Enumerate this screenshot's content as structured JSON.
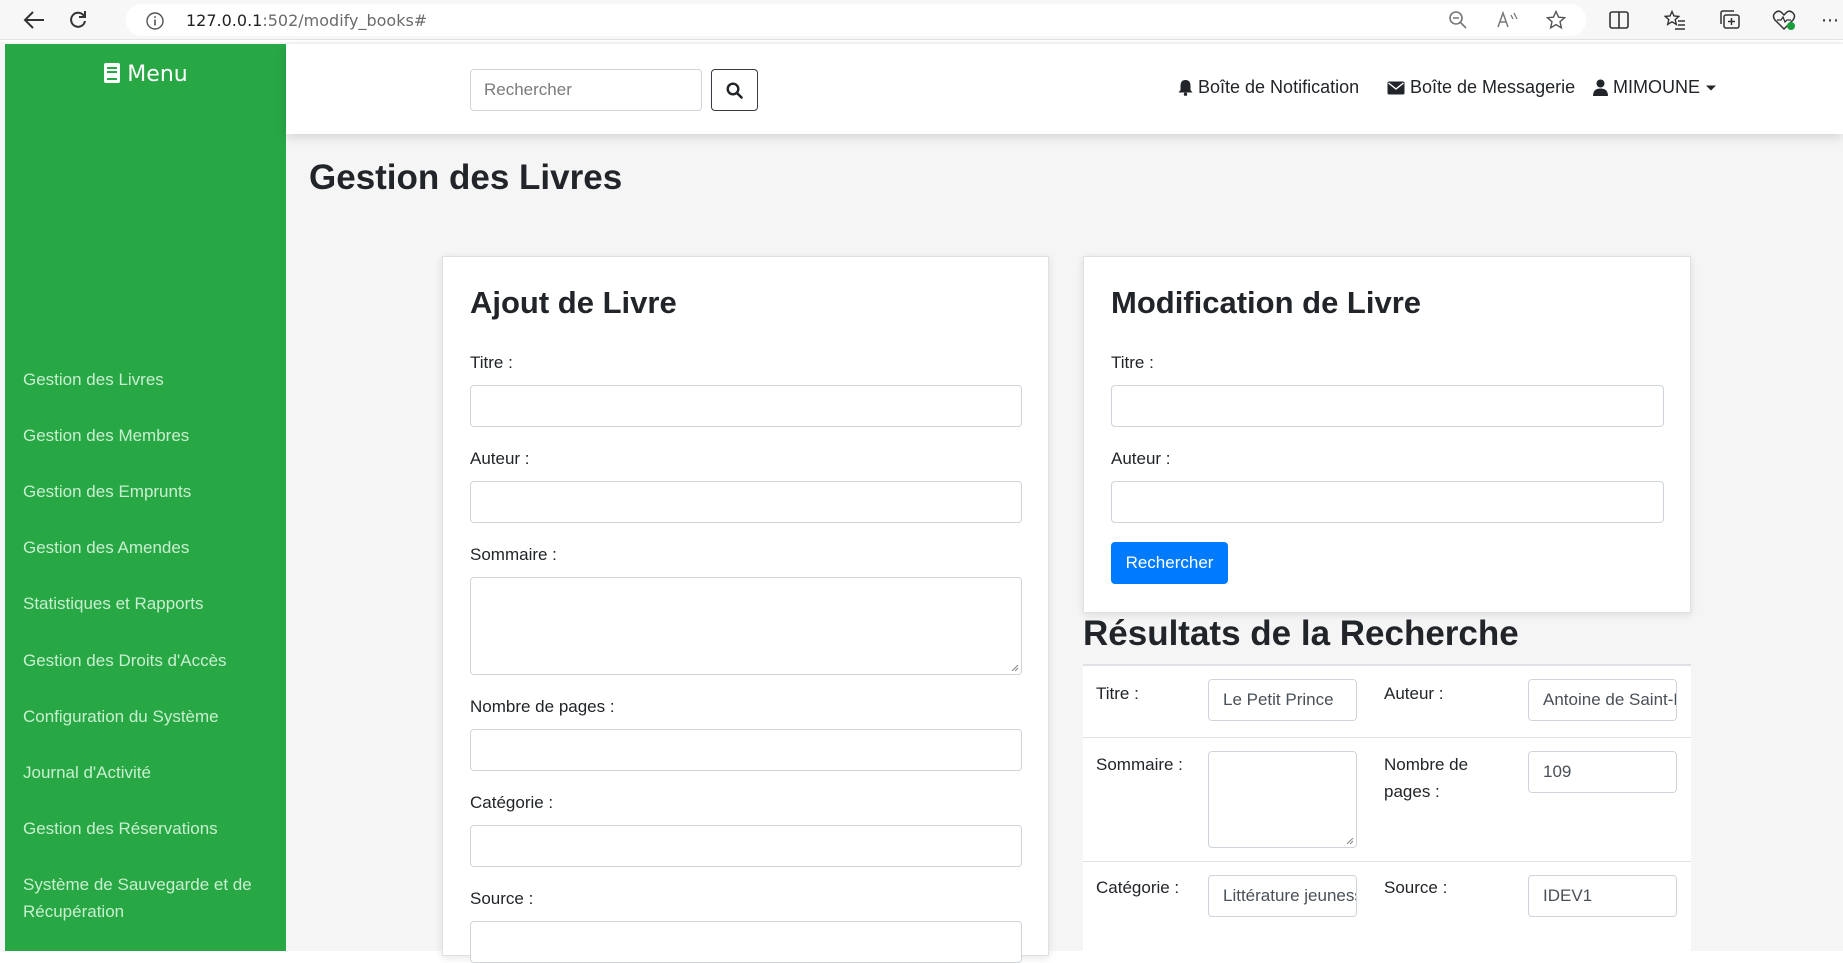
{
  "browser": {
    "url_host": "127.0.0.1",
    "url_path": ":502/modify_books#"
  },
  "sidebar": {
    "title": "Menu",
    "items": [
      {
        "label": "Gestion des Livres"
      },
      {
        "label": "Gestion des Membres"
      },
      {
        "label": "Gestion des Emprunts"
      },
      {
        "label": "Gestion des Amendes"
      },
      {
        "label": "Statistiques et Rapports"
      },
      {
        "label": "Gestion des Droits d'Accès"
      },
      {
        "label": "Configuration du Système"
      },
      {
        "label": "Journal d'Activité"
      },
      {
        "label": "Gestion des Réservations"
      },
      {
        "label": "Système de Sauvegarde et de Récupération"
      }
    ]
  },
  "topbar": {
    "search_placeholder": "Rechercher",
    "notifications": "Boîte de Notification",
    "messages": "Boîte de Messagerie",
    "user": "MIMOUNE"
  },
  "main": {
    "title": "Gestion des Livres"
  },
  "add_form": {
    "title": "Ajout de Livre",
    "titre_label": "Titre :",
    "auteur_label": "Auteur :",
    "sommaire_label": "Sommaire :",
    "pages_label": "Nombre de pages :",
    "categorie_label": "Catégorie :",
    "source_label": "Source :"
  },
  "modify_form": {
    "title": "Modification de Livre",
    "titre_label": "Titre :",
    "auteur_label": "Auteur :",
    "search_button": "Rechercher"
  },
  "results": {
    "title": "Résultats de la Recherche",
    "titre_label": "Titre :",
    "titre_value": "Le Petit Prince",
    "auteur_label": "Auteur :",
    "auteur_value": "Antoine de Saint-Exupéry",
    "sommaire_label": "Sommaire :",
    "sommaire_value": "",
    "pages_label": "Nombre de pages :",
    "pages_value": "109",
    "categorie_label": "Catégorie :",
    "categorie_value": "Littérature jeunesse",
    "source_label": "Source :",
    "source_value": "IDEV1"
  }
}
